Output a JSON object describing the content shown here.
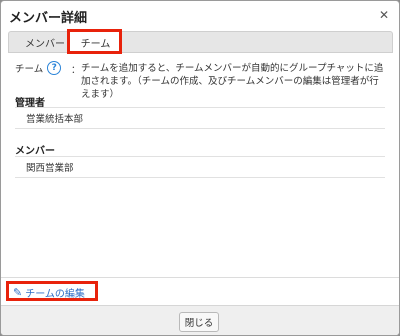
{
  "dialog": {
    "title": "メンバー詳細",
    "close_icon": "✕"
  },
  "tabs": [
    {
      "label": "メンバー",
      "active": false
    },
    {
      "label": "チーム",
      "active": true
    }
  ],
  "team": {
    "label": "チーム",
    "help_icon": "?",
    "colon": "：",
    "description": "チームを追加すると、チームメンバーが自動的にグループチャットに追加されます。（チームの作成、及びチームメンバーの編集は管理者が行えます）",
    "sections": [
      {
        "heading": "管理者",
        "items": [
          "営業統括本部"
        ]
      },
      {
        "heading": "メンバー",
        "items": [
          "関西営業部"
        ]
      }
    ]
  },
  "footer": {
    "edit_link_icon": "pencil-icon",
    "edit_link_label": "チームの編集",
    "close_button_label": "閉じる"
  },
  "colors": {
    "highlight": "#e8220b",
    "link": "#2f6fc6",
    "help_icon": "#2b84d8"
  }
}
